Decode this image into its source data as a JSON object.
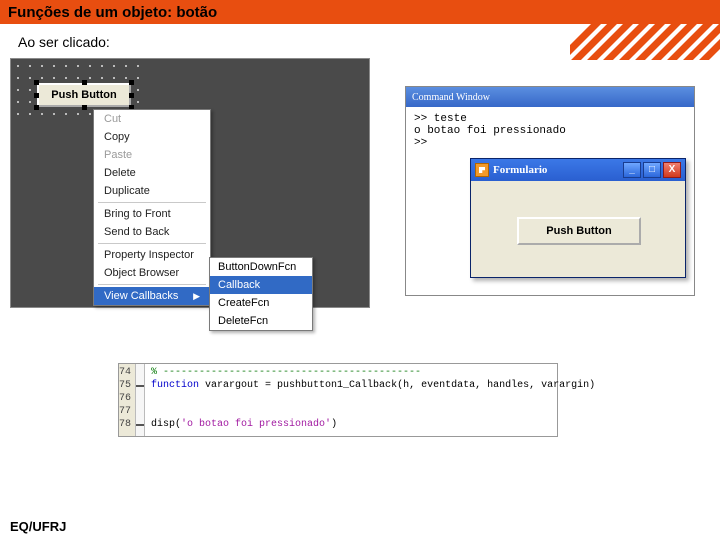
{
  "title": "Funções de um objeto: botão",
  "subtitle": "Ao ser clicado:",
  "footer": "EQ/UFRJ",
  "guide": {
    "pushbutton_label": "Push Button",
    "context_menu": [
      {
        "label": "Cut",
        "disabled": true
      },
      {
        "label": "Copy"
      },
      {
        "label": "Paste",
        "disabled": true
      },
      {
        "label": "Delete"
      },
      {
        "label": "Duplicate"
      },
      {
        "sep": true
      },
      {
        "label": "Bring to Front"
      },
      {
        "label": "Send to Back"
      },
      {
        "sep": true
      },
      {
        "label": "Property Inspector"
      },
      {
        "label": "Object Browser"
      },
      {
        "sep": true
      },
      {
        "label": "View Callbacks",
        "submenu": true,
        "hover": true
      }
    ],
    "submenu": [
      {
        "label": "ButtonDownFcn"
      },
      {
        "label": "Callback",
        "hover": true
      },
      {
        "label": "CreateFcn"
      },
      {
        "label": "DeleteFcn"
      }
    ]
  },
  "cmdwindow": {
    "title": "Command Window",
    "lines": {
      "l1": ">> teste",
      "l2": "o botao foi pressionado",
      "l3": ">>"
    }
  },
  "formwin": {
    "title": "Formulario",
    "btns": {
      "min": "_",
      "max": "□",
      "close": "X"
    },
    "button_label": "Push Button"
  },
  "editor": {
    "gutter": [
      "74",
      "75",
      "76",
      "77",
      "78"
    ],
    "code": {
      "l1_cm": "% -------------------------------------------",
      "l2_kw": "function",
      "l2_rest": " varargout = pushbutton1_Callback(h, eventdata, handles, varargin)",
      "l4a": "disp(",
      "l4_str": "'o botao foi pressionado'",
      "l4b": ")"
    }
  }
}
